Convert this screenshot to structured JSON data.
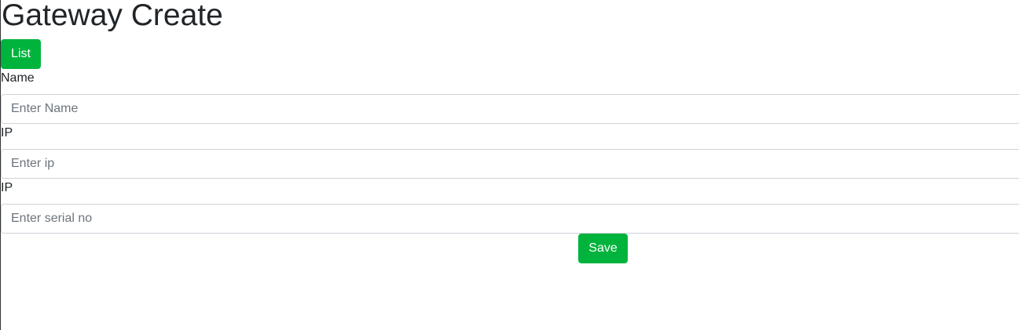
{
  "page": {
    "title": "Gateway Create"
  },
  "toolbar": {
    "list_label": "List"
  },
  "form": {
    "name": {
      "label": "Name",
      "value": "",
      "placeholder": "Enter Name"
    },
    "ip": {
      "label": "IP",
      "value": "",
      "placeholder": "Enter ip"
    },
    "serial": {
      "label": "IP",
      "value": "",
      "placeholder": "Enter serial no"
    },
    "save_label": "Save"
  },
  "colors": {
    "button_bg": "#00b33c",
    "button_text": "#ffffff",
    "input_border": "#ced4da",
    "text": "#212529",
    "placeholder": "#6c757d"
  }
}
